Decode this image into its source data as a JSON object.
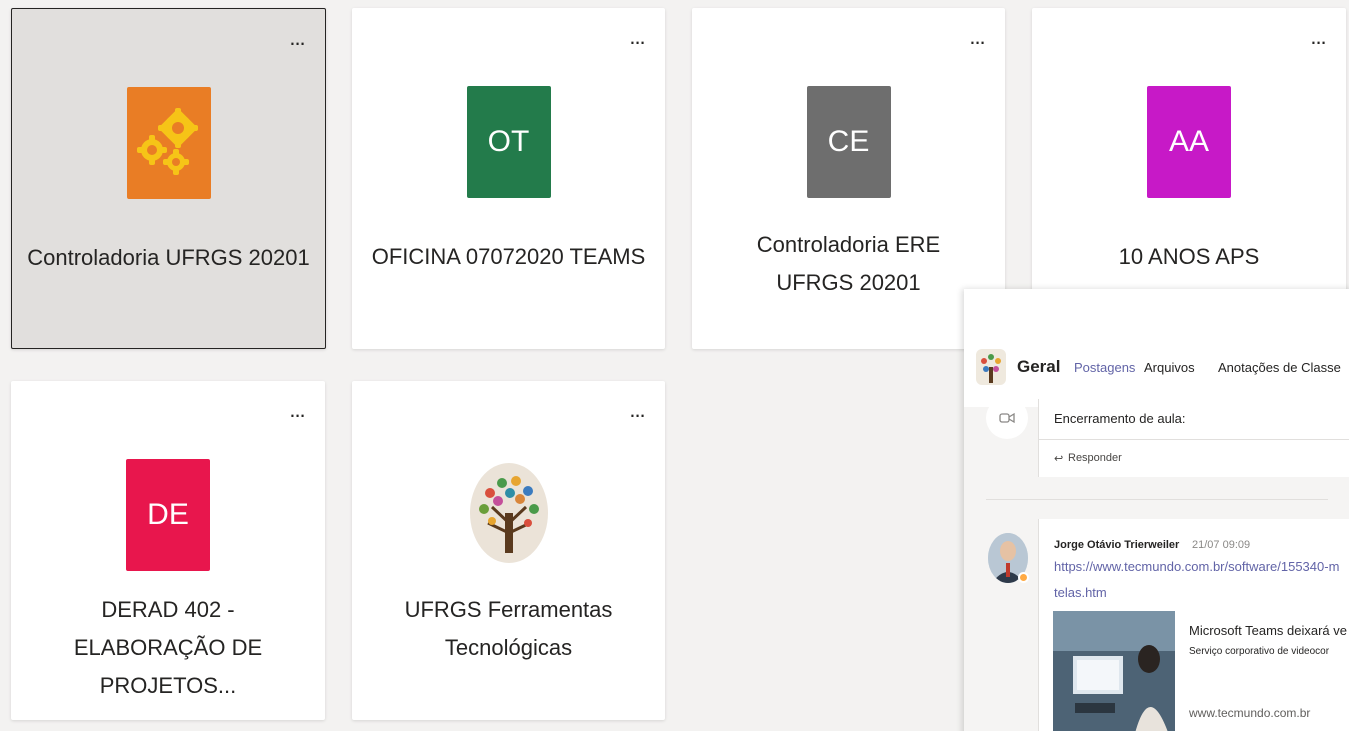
{
  "teams": [
    {
      "name": "Controladoria UFRGS 20201",
      "initials": "",
      "avatar_color": "#e97d25",
      "icon": "gears-icon",
      "more": "..."
    },
    {
      "name": "OFICINA 07072020 TEAMS",
      "initials": "OT",
      "avatar_color": "#237b4b",
      "more": "..."
    },
    {
      "name": "Controladoria ERE UFRGS 20201",
      "initials": "CE",
      "avatar_color": "#6e6e6e",
      "more": "..."
    },
    {
      "name": "10 ANOS APS",
      "initials": "AA",
      "avatar_color": "#c719c7",
      "more": "..."
    },
    {
      "name": "DERAD 402 - ELABORAÇÃO DE PROJETOS...",
      "initials": "DE",
      "avatar_color": "#e8164d",
      "more": "..."
    },
    {
      "name": "UFRGS Ferramentas Tecnológicas",
      "initials": "",
      "avatar_color": "#ebe3d8",
      "icon": "tree-icon",
      "more": "..."
    }
  ],
  "channel": {
    "name": "Geral",
    "tabs": [
      "Postagens",
      "Arquivos",
      "Anotações de Classe"
    ],
    "active_tab": "Postagens"
  },
  "messages": {
    "first": {
      "text": "Encerramento de aula:",
      "reply_label": "Responder"
    },
    "second": {
      "author": "Jorge Otávio Trierweiler",
      "time": "21/07 09:09",
      "link_line1": "https://www.tecmundo.com.br/software/155340-m",
      "link_line2": "telas.htm",
      "preview_title": "Microsoft Teams deixará ve",
      "preview_desc": "Serviço corporativo de videocor",
      "preview_domain": "www.tecmundo.com.br"
    }
  },
  "colors": {
    "accent": "#6264a7",
    "background": "#f3f2f1"
  }
}
